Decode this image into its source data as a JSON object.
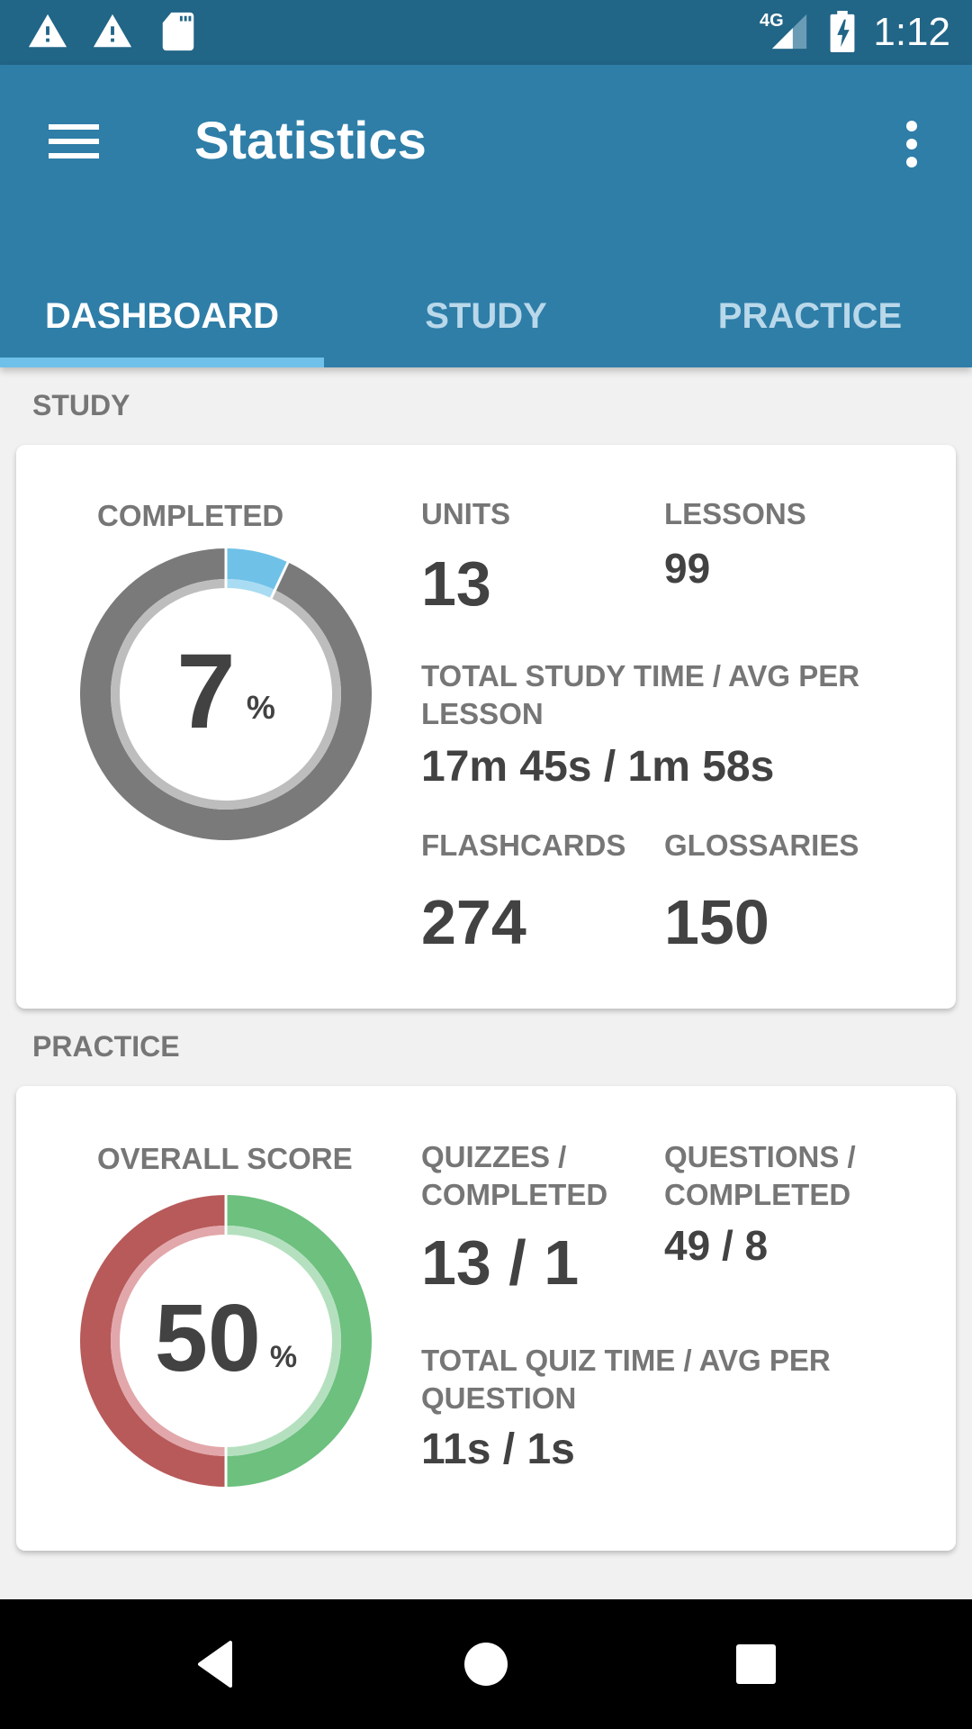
{
  "status_bar": {
    "time": "1:12",
    "network": "4G",
    "icons": [
      "warning-icon",
      "warning-icon",
      "sd-card-icon",
      "signal-4g-icon",
      "battery-charging-icon"
    ]
  },
  "app_bar": {
    "title": "Statistics",
    "menu_icon": "hamburger-menu-icon",
    "overflow_icon": "more-vert-icon"
  },
  "tabs": [
    {
      "label": "DASHBOARD",
      "active": true
    },
    {
      "label": "STUDY",
      "active": false
    },
    {
      "label": "PRACTICE",
      "active": false
    }
  ],
  "study": {
    "section_label": "STUDY",
    "completed_label": "COMPLETED",
    "completed_value": "7",
    "completed_fraction": 0.07,
    "percent_sign": "%",
    "units_label": "UNITS",
    "units_value": "13",
    "lessons_label": "LESSONS",
    "lessons_value": "99",
    "time_label": "TOTAL STUDY TIME / AVG PER LESSON",
    "time_value": "17m 45s / 1m 58s",
    "flashcards_label": "FLASHCARDS",
    "flashcards_value": "274",
    "glossaries_label": "GLOSSARIES",
    "glossaries_value": "150",
    "colors": {
      "done": "#6fc1e8",
      "done_inner": "#a9dcf3",
      "remaining": "#7a7a7a",
      "remaining_inner": "#bdbdbd"
    }
  },
  "practice": {
    "section_label": "PRACTICE",
    "score_label": "OVERALL SCORE",
    "score_value": "50",
    "score_fraction": 0.5,
    "percent_sign": "%",
    "quizzes_label": "QUIZZES / COMPLETED",
    "quizzes_value": "13 / 1",
    "questions_label": "QUESTIONS / COMPLETED",
    "questions_value": "49 / 8",
    "time_label": "TOTAL QUIZ TIME / AVG PER QUESTION",
    "time_value": "11s / 1s",
    "colors": {
      "correct": "#6dc07e",
      "correct_inner": "#b5e0bf",
      "wrong": "#b85a5a",
      "wrong_inner": "#e2a7aa"
    }
  },
  "nav_bar": {
    "back_icon": "back-triangle-icon",
    "home_icon": "home-circle-icon",
    "recents_icon": "recents-square-icon"
  }
}
